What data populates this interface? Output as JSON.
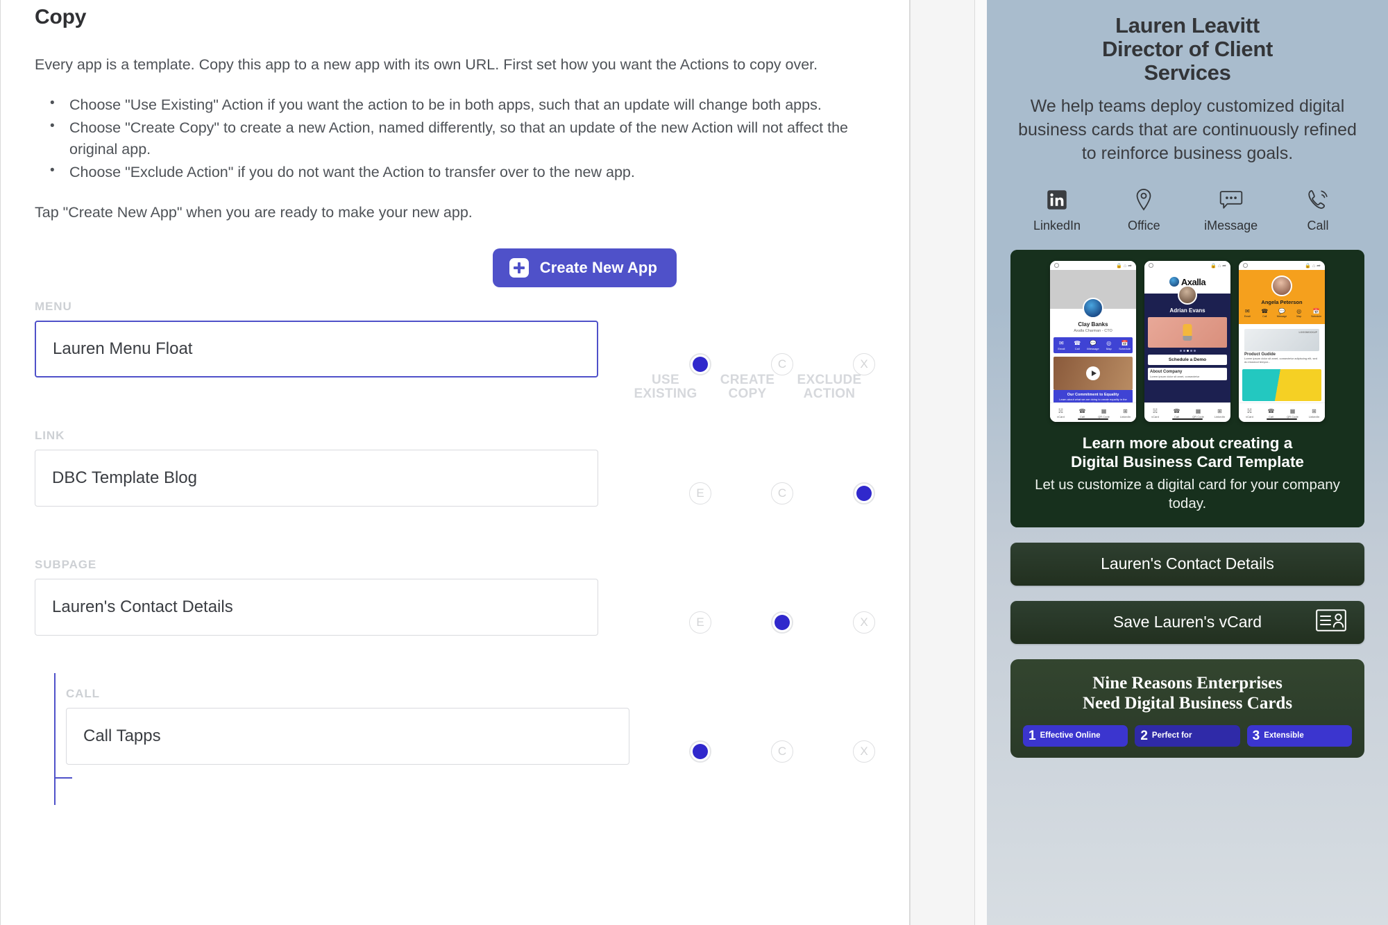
{
  "left": {
    "title": "Copy",
    "intro": "Every app is a template. Copy this app to a new app with its own URL. First set how you want the Actions to copy over.",
    "bullets": [
      "Choose \"Use Existing\" Action if you want the action to be in both apps, such that an update will change both apps.",
      "Choose \"Create Copy\" to create a new Action, named differently, so that an update of the new Action will not affect the original app.",
      "Choose \"Exclude Action\" if you do not want the Action to transfer over to the new app."
    ],
    "tap_note": "Tap \"Create New App\" when you are ready to make your new app.",
    "create_button": {
      "label": "Create New App",
      "icon": "plus-square-icon",
      "color": "#4f51c9"
    },
    "columns": [
      {
        "line1": "USE",
        "line2": "EXISTING",
        "key": "use_existing",
        "marker": "E"
      },
      {
        "line1": "CREATE",
        "line2": "COPY",
        "key": "create_copy",
        "marker": "C"
      },
      {
        "line1": "EXCLUDE",
        "line2": "ACTION",
        "key": "exclude_action",
        "marker": "X"
      }
    ],
    "rows": [
      {
        "label": "MENU",
        "value": "Lauren Menu Float",
        "focused": true,
        "nested": false,
        "selected": "use_existing"
      },
      {
        "label": "LINK",
        "value": "DBC Template Blog",
        "focused": false,
        "nested": false,
        "selected": "exclude_action"
      },
      {
        "label": "SUBPAGE",
        "value": "Lauren's Contact Details",
        "focused": false,
        "nested": false,
        "selected": "create_copy"
      },
      {
        "label": "CALL",
        "value": "Call Tapps",
        "focused": false,
        "nested": true,
        "selected": "use_existing"
      }
    ]
  },
  "preview": {
    "name": "Lauren Leavitt",
    "role_line1": "Director of Client",
    "role_line2": "Services",
    "tagline": "We help teams deploy customized digital business cards that are continuously refined to reinforce business goals.",
    "icons": [
      {
        "label": "LinkedIn",
        "icon": "linkedin-icon"
      },
      {
        "label": "Office",
        "icon": "map-pin-icon"
      },
      {
        "label": "iMessage",
        "icon": "chat-bubble-icon"
      },
      {
        "label": "Call",
        "icon": "phone-icon"
      }
    ],
    "media_card": {
      "headline_line1": "Learn more about creating a",
      "headline_line2": "Digital Business Card Template",
      "subline": "Let us customize a digital card for your company today.",
      "background": "#17301d",
      "phones": [
        {
          "name": "Clay Banks",
          "subtitle": "Axalla Charman - CTO",
          "actions": [
            "Email",
            "Call",
            "iMessage",
            "Map",
            "Schedule"
          ],
          "band_title": "Our Commitment to Equality",
          "band_text": "Learn about what we are doing to create equality in the workplace and our comunity.",
          "footer": [
            "vCard",
            "Call",
            "QR Code",
            "LinkedIn"
          ]
        },
        {
          "logo": "Axalla",
          "name": "Adrian Evans",
          "cta": "Schedule a Demo",
          "card_title": "About Company",
          "card_text": "Lorem ipsum dolor sit amet, consectetur",
          "footer": [
            "vCard",
            "Call",
            "QR Code",
            "LinkedIn"
          ]
        },
        {
          "name": "Angela Peterson",
          "actions": [
            "Email",
            "Call",
            "Message",
            "Map",
            "Schedule"
          ],
          "product_title": "Product Gudide",
          "product_text": "Lorem ipsum dolor sit amet, consectetur adipiscing elit, sed do eiusmod tempor...",
          "logo_mock": "LOGOMOCKUP",
          "footer": [
            "vCard",
            "Call",
            "QR Code",
            "LinkedIn"
          ]
        }
      ]
    },
    "buttons": [
      {
        "label": "Lauren's Contact Details",
        "icon": null
      },
      {
        "label": "Save Lauren's vCard",
        "icon": "vcard-icon"
      }
    ],
    "reasons": {
      "title_line1": "Nine Reasons Enterprises",
      "title_line2": "Need Digital Business Cards",
      "chips": [
        {
          "num": "1",
          "text": "Effective Online"
        },
        {
          "num": "2",
          "text": "Perfect for"
        },
        {
          "num": "3",
          "text": "Extensible"
        }
      ]
    }
  }
}
